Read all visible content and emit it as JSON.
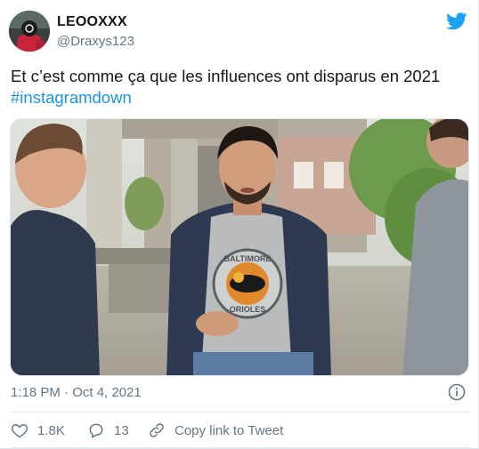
{
  "user": {
    "display_name": "LEOOXXX",
    "handle": "@Draxys123"
  },
  "tweet": {
    "text": "Et c’est comme ça que les influences ont disparus en 2021",
    "hashtag": "#instagramdown",
    "timestamp": "1:18 PM · Oct 4, 2021"
  },
  "media": {
    "shirt_text_top": "BALTIMORE",
    "shirt_text_bottom": "ORIOLES"
  },
  "actions": {
    "likes": "1.8K",
    "replies": "13",
    "copy_link_label": "Copy link to Tweet"
  },
  "colors": {
    "link": "#1b95e0",
    "twitter_blue": "#1da1f2",
    "like_red": "#e0245e",
    "secondary_text": "#657786"
  },
  "icons": {
    "logo": "twitter-bird-icon",
    "info": "info-icon",
    "like": "heart-icon",
    "reply": "reply-bubble-icon",
    "copy": "link-icon"
  }
}
